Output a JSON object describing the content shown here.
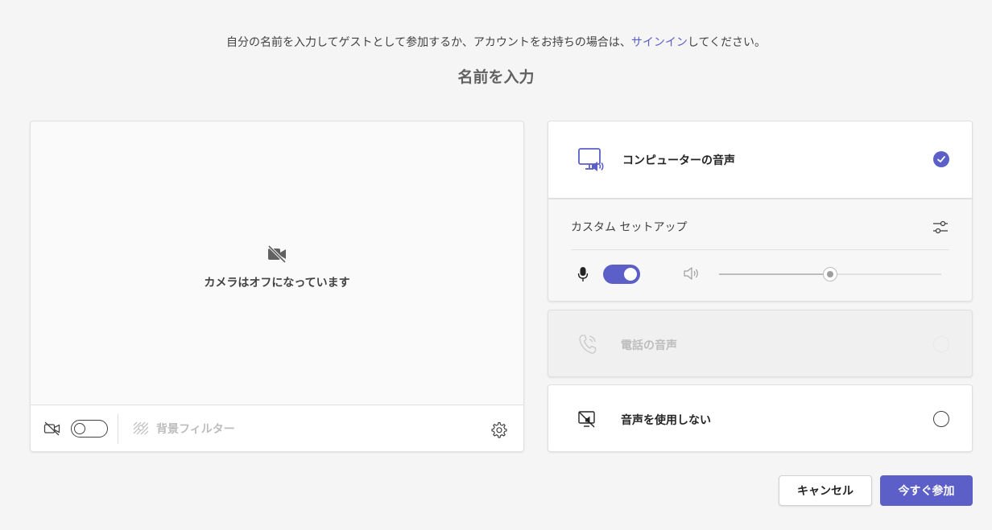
{
  "intro": {
    "text_before": "自分の名前を入力してゲストとして参加するか、アカウントをお持ちの場合は、",
    "signin_link": "サインイン",
    "text_after": "してください。"
  },
  "name_input": {
    "placeholder": "名前を入力",
    "value": ""
  },
  "camera": {
    "off_message": "カメラはオフになっています",
    "toggle_on": false,
    "background_filter_label": "背景フィルター"
  },
  "audio": {
    "computer_audio_label": "コンピューターの音声",
    "computer_audio_selected": true,
    "custom_setup_label": "カスタム セットアップ",
    "mic_on": true,
    "speaker_volume_fraction": 0.5,
    "phone_audio_label": "電話の音声",
    "phone_audio_disabled": true,
    "no_audio_label": "音声を使用しない",
    "no_audio_selected": false
  },
  "buttons": {
    "cancel": "キャンセル",
    "join_now": "今すぐ参加"
  },
  "colors": {
    "accent": "#5b5fc7",
    "background": "#f5f5f5",
    "disabled_text": "#bdbdbd"
  },
  "icons": {
    "camera_off": "video-off-icon",
    "background_filter": "background-effects-icon",
    "settings": "gear-icon",
    "computer_audio": "computer-speaker-icon",
    "selected": "checkmark-icon",
    "custom_setup": "sliders-icon",
    "microphone": "microphone-icon",
    "speaker": "speaker-icon",
    "phone": "phone-icon",
    "no_audio": "speaker-off-icon"
  }
}
